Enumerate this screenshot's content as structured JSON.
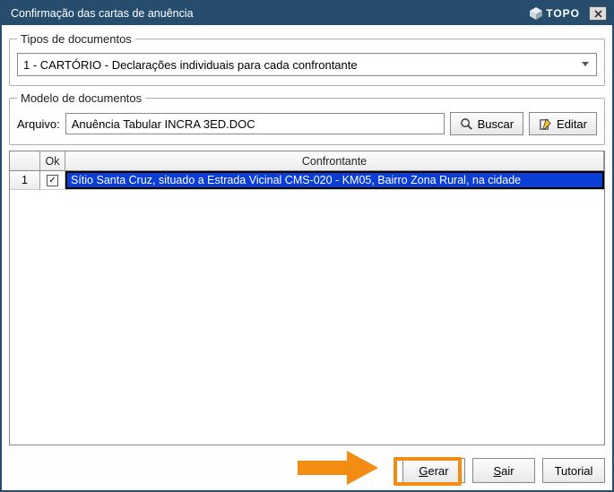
{
  "window": {
    "title": "Confirmação das cartas de anuência",
    "brand": "TOPO"
  },
  "tipos": {
    "legend": "Tipos de documentos",
    "selected": "1 - CARTÓRIO - Declarações individuais para cada confrontante"
  },
  "modelo": {
    "legend": "Modelo de documentos",
    "arquivo_label": "Arquivo:",
    "arquivo_value": "Anuência Tabular INCRA 3ED.DOC",
    "buscar_label": "Buscar",
    "editar_label": "Editar"
  },
  "table": {
    "col_ok": "Ok",
    "col_confrontante": "Confrontante",
    "rows": [
      {
        "num": "1",
        "checked": true,
        "confrontante": "Sítio Santa Cruz, situado a Estrada Vicinal CMS-020 - KM05, Bairro Zona Rural, na cidade"
      }
    ]
  },
  "footer": {
    "gerar": "Gerar",
    "sair": "Sair",
    "tutorial": "Tutorial"
  }
}
